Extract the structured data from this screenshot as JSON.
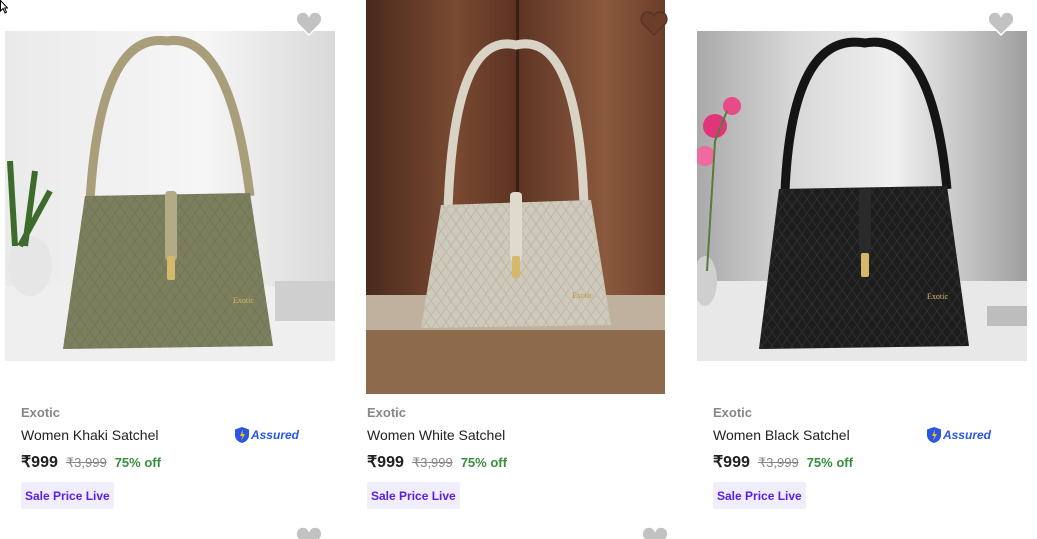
{
  "products": [
    {
      "brand": "Exotic",
      "title": "Women Khaki Satchel",
      "assured": "Assured",
      "price": "₹999",
      "mrp": "₹3,999",
      "discount": "75% off",
      "badge": "Sale Price Live",
      "bag_color": "#7c7f5d"
    },
    {
      "brand": "Exotic",
      "title": "Women White Satchel",
      "assured": "",
      "price": "₹999",
      "mrp": "₹3,999",
      "discount": "75% off",
      "badge": "Sale Price Live",
      "bag_color": "#cfc9bb"
    },
    {
      "brand": "Exotic",
      "title": "Women Black Satchel",
      "assured": "Assured",
      "price": "₹999",
      "mrp": "₹3,999",
      "discount": "75% off",
      "badge": "Sale Price Live",
      "bag_color": "#1d1d1d"
    }
  ],
  "colors": {
    "discount": "#388e3c",
    "badge_text": "#5c1ee5",
    "badge_bg": "#f1eefc",
    "assured": "#2a55e5",
    "wishlist": "#c2c2c2"
  },
  "icons": {
    "wishlist": "heart-icon",
    "assured": "assured-shield-icon",
    "cursor": "mouse-cursor-icon"
  }
}
